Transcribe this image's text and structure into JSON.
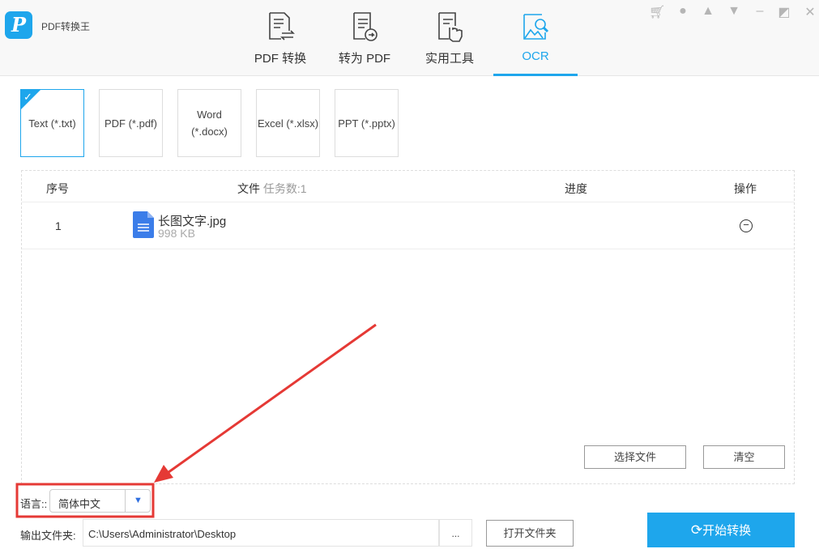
{
  "app": {
    "name": "PDF转换王",
    "logo_letter": "P"
  },
  "tabs": [
    {
      "label": "PDF 转换"
    },
    {
      "label": "转为 PDF"
    },
    {
      "label": "实用工具"
    },
    {
      "label": "OCR",
      "active": true
    }
  ],
  "window_controls": [
    "cart-icon",
    "user-icon",
    "bell-icon",
    "dropdown-icon",
    "minimize-icon",
    "restore-icon",
    "close-icon"
  ],
  "formats": [
    {
      "label": "Text (*.txt)",
      "selected": true
    },
    {
      "label": "PDF (*.pdf)"
    },
    {
      "label": "Word (*.docx)"
    },
    {
      "label": "Excel (*.xlsx)"
    },
    {
      "label": "PPT (*.pptx)"
    }
  ],
  "table": {
    "col_index": "序号",
    "col_file": "文件",
    "task_count": "任务数:1",
    "col_progress": "进度",
    "col_action": "操作",
    "rows": [
      {
        "index": "1",
        "name": "长图文字.jpg",
        "size": "998 KB"
      }
    ]
  },
  "buttons": {
    "select_files": "选择文件",
    "clear": "清空",
    "open_folder": "打开文件夹",
    "browse": "...",
    "start": "开始转换"
  },
  "language": {
    "label": "语言::",
    "value": "简体中文"
  },
  "output": {
    "label": "输出文件夹:",
    "path": "C:\\Users\\Administrator\\Desktop"
  },
  "colors": {
    "accent": "#1ea6ec",
    "annotation": "#e53935"
  }
}
